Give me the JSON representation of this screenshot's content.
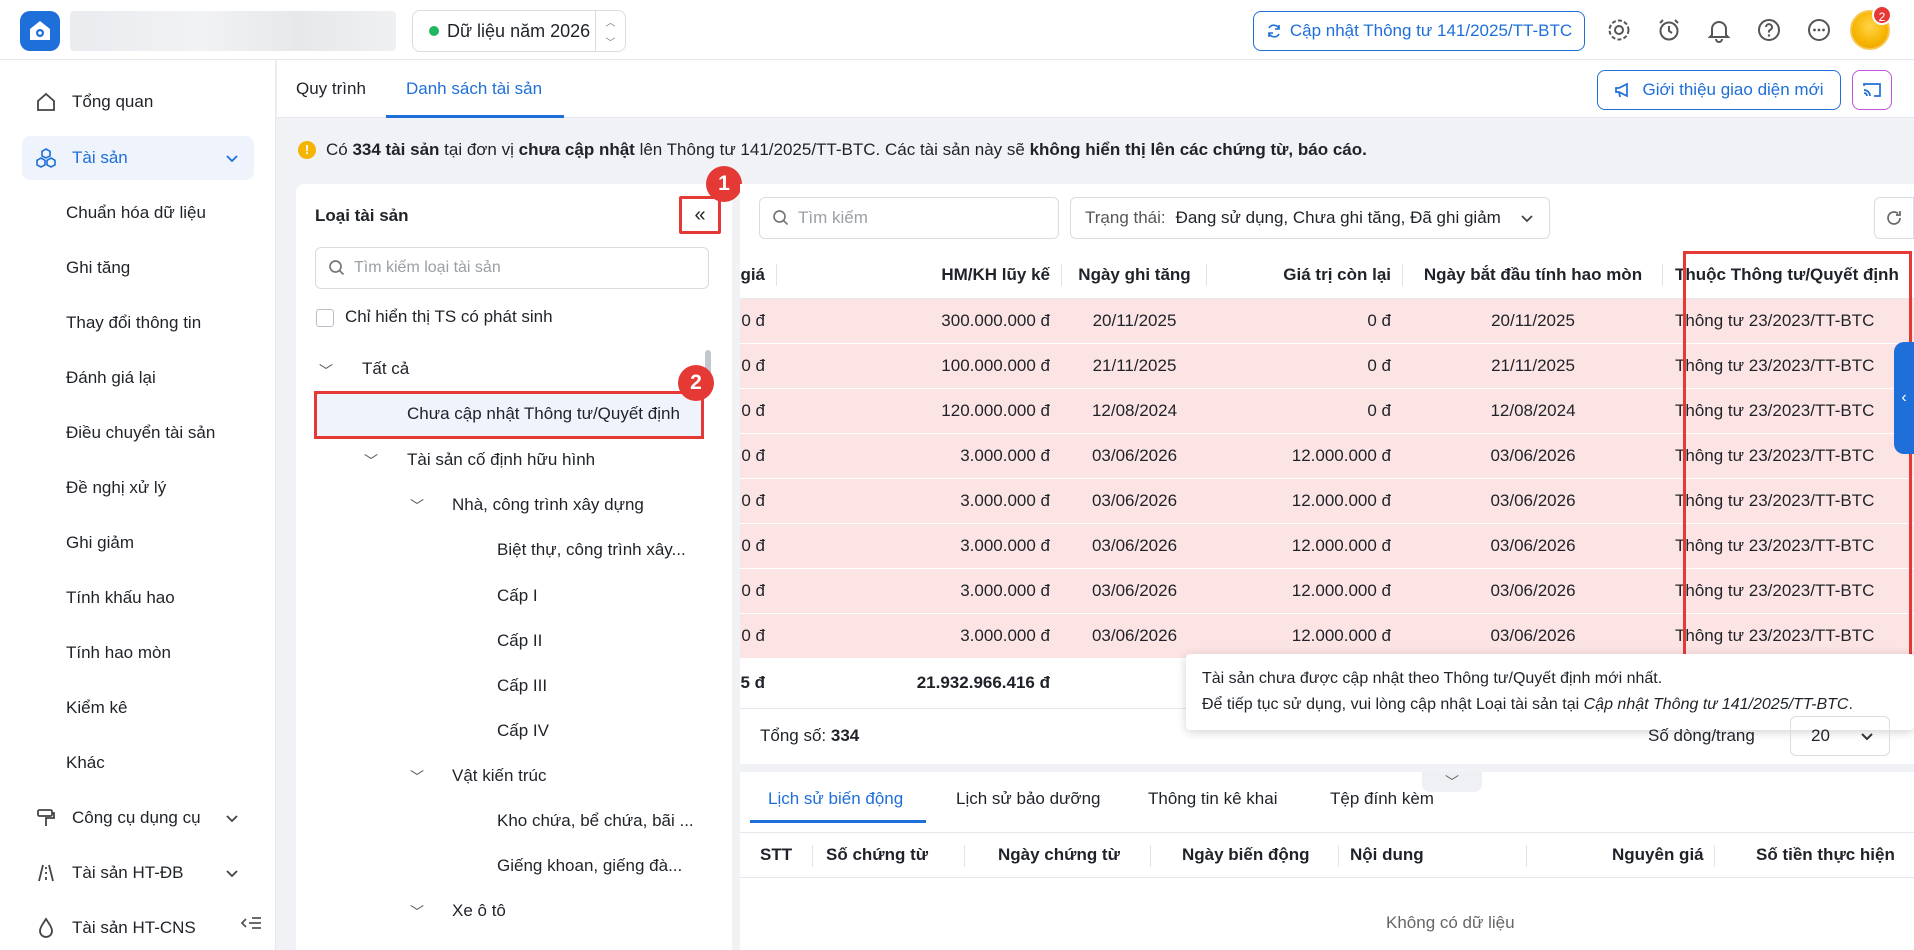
{
  "header": {
    "year_label": "Dữ liệu năm 2026",
    "update_button": "Cập nhật Thông tư 141/2025/TT-BTC",
    "notification_count": "2"
  },
  "sidebar": {
    "items": [
      {
        "label": "Tổng quan"
      },
      {
        "label": "Tài sản"
      },
      {
        "label": "Chuẩn hóa dữ liệu"
      },
      {
        "label": "Ghi tăng"
      },
      {
        "label": "Thay đổi thông tin"
      },
      {
        "label": "Đánh giá lại"
      },
      {
        "label": "Điều chuyển tài sản"
      },
      {
        "label": "Đề nghị xử lý"
      },
      {
        "label": "Ghi giảm"
      },
      {
        "label": "Tính khấu hao"
      },
      {
        "label": "Tính hao mòn"
      },
      {
        "label": "Kiểm kê"
      },
      {
        "label": "Khác"
      },
      {
        "label": "Công cụ dụng cụ"
      },
      {
        "label": "Tài sản HT-ĐB"
      },
      {
        "label": "Tài sản HT-CNS"
      }
    ]
  },
  "tabs": {
    "process": "Quy trình",
    "asset_list": "Danh sách tài sản",
    "intro_button": "Giới thiệu giao diện mới"
  },
  "notice": {
    "p1": "Có ",
    "count": "334 tài sản",
    "p2": " tại đơn vị ",
    "not_updated": "chưa cập nhật",
    "p3": " lên Thông tư 141/2025/TT-BTC. Các tài sản này sẽ ",
    "not_shown": "không hiển thị lên các chứng từ, báo cáo."
  },
  "left_panel": {
    "title": "Loại tài sản",
    "collapse_glyph": "«",
    "search_placeholder": "Tìm kiếm loại tài sản",
    "checkbox_label": "Chỉ hiển thị TS có phát sinh",
    "markers": [
      "1",
      "2"
    ],
    "tree": [
      {
        "label": "Tất cả"
      },
      {
        "label": "Chưa cập nhật Thông tư/Quyết định"
      },
      {
        "label": "Tài sản cố định hữu hình"
      },
      {
        "label": "Nhà, công trình xây dựng"
      },
      {
        "label": "Biệt thự, công trình xây..."
      },
      {
        "label": "Cấp I"
      },
      {
        "label": "Cấp II"
      },
      {
        "label": "Cấp III"
      },
      {
        "label": "Cấp IV"
      },
      {
        "label": "Vật kiến trúc"
      },
      {
        "label": "Kho chứa, bể chứa, bãi ..."
      },
      {
        "label": "Giếng khoan, giếng đà..."
      },
      {
        "label": "Xe ô tô"
      }
    ]
  },
  "filters": {
    "search_placeholder": "Tìm kiếm",
    "status_label": "Trạng thái:",
    "status_value": "Đang sử dụng, Chưa ghi tăng, Đã ghi giảm"
  },
  "grid": {
    "headers": [
      "giá",
      "HM/KH lũy kế",
      "Ngày ghi tăng",
      "Giá trị còn lại",
      "Ngày bắt đầu tính hao mòn",
      "Thuộc Thông tư/Quyết định"
    ],
    "rows": [
      [
        "0 đ",
        "300.000.000 đ",
        "20/11/2025",
        "0 đ",
        "20/11/2025",
        "Thông tư 23/2023/TT-BTC"
      ],
      [
        "0 đ",
        "100.000.000 đ",
        "21/11/2025",
        "0 đ",
        "21/11/2025",
        "Thông tư 23/2023/TT-BTC"
      ],
      [
        "0 đ",
        "120.000.000 đ",
        "12/08/2024",
        "0 đ",
        "12/08/2024",
        "Thông tư 23/2023/TT-BTC"
      ],
      [
        "0 đ",
        "3.000.000 đ",
        "03/06/2026",
        "12.000.000 đ",
        "03/06/2026",
        "Thông tư 23/2023/TT-BTC"
      ],
      [
        "0 đ",
        "3.000.000 đ",
        "03/06/2026",
        "12.000.000 đ",
        "03/06/2026",
        "Thông tư 23/2023/TT-BTC"
      ],
      [
        "0 đ",
        "3.000.000 đ",
        "03/06/2026",
        "12.000.000 đ",
        "03/06/2026",
        "Thông tư 23/2023/TT-BTC"
      ],
      [
        "0 đ",
        "3.000.000 đ",
        "03/06/2026",
        "12.000.000 đ",
        "03/06/2026",
        "Thông tư 23/2023/TT-BTC"
      ],
      [
        "0 đ",
        "3.000.000 đ",
        "03/06/2026",
        "12.000.000 đ",
        "03/06/2026",
        "Thông tư 23/2023/TT-BTC"
      ]
    ],
    "totals": [
      "5 đ",
      "21.932.966.416 đ",
      "",
      "",
      "",
      ""
    ]
  },
  "tooltip": {
    "line1": "Tài sản chưa được cập nhật theo Thông tư/Quyết định mới nhất.",
    "line2_prefix": "Để tiếp tục sử dụng, vui lòng cập nhật Loại tài sản tại ",
    "line2_link": "Cập nhật Thông tư 141/2025/TT-BTC",
    "line2_suffix": "."
  },
  "footer": {
    "total_label": "Tổng số: ",
    "total_value": "334",
    "rows_per_page_label": "Số dòng/trang",
    "rows_per_page_value": "20"
  },
  "bottom": {
    "tabs": [
      "Lịch sử biến động",
      "Lịch sử bảo dưỡng",
      "Thông tin kê khai",
      "Tệp đính kèm"
    ],
    "headers": [
      "STT",
      "Số chứng từ",
      "Ngày chứng từ",
      "Ngày biến động",
      "Nội dung",
      "Nguyên giá",
      "Số tiền thực hiện"
    ],
    "empty": "Không có dữ liệu"
  },
  "colors": {
    "accent": "#1e6fd9",
    "highlight": "#e53935",
    "row_bg": "#fce4e4"
  }
}
